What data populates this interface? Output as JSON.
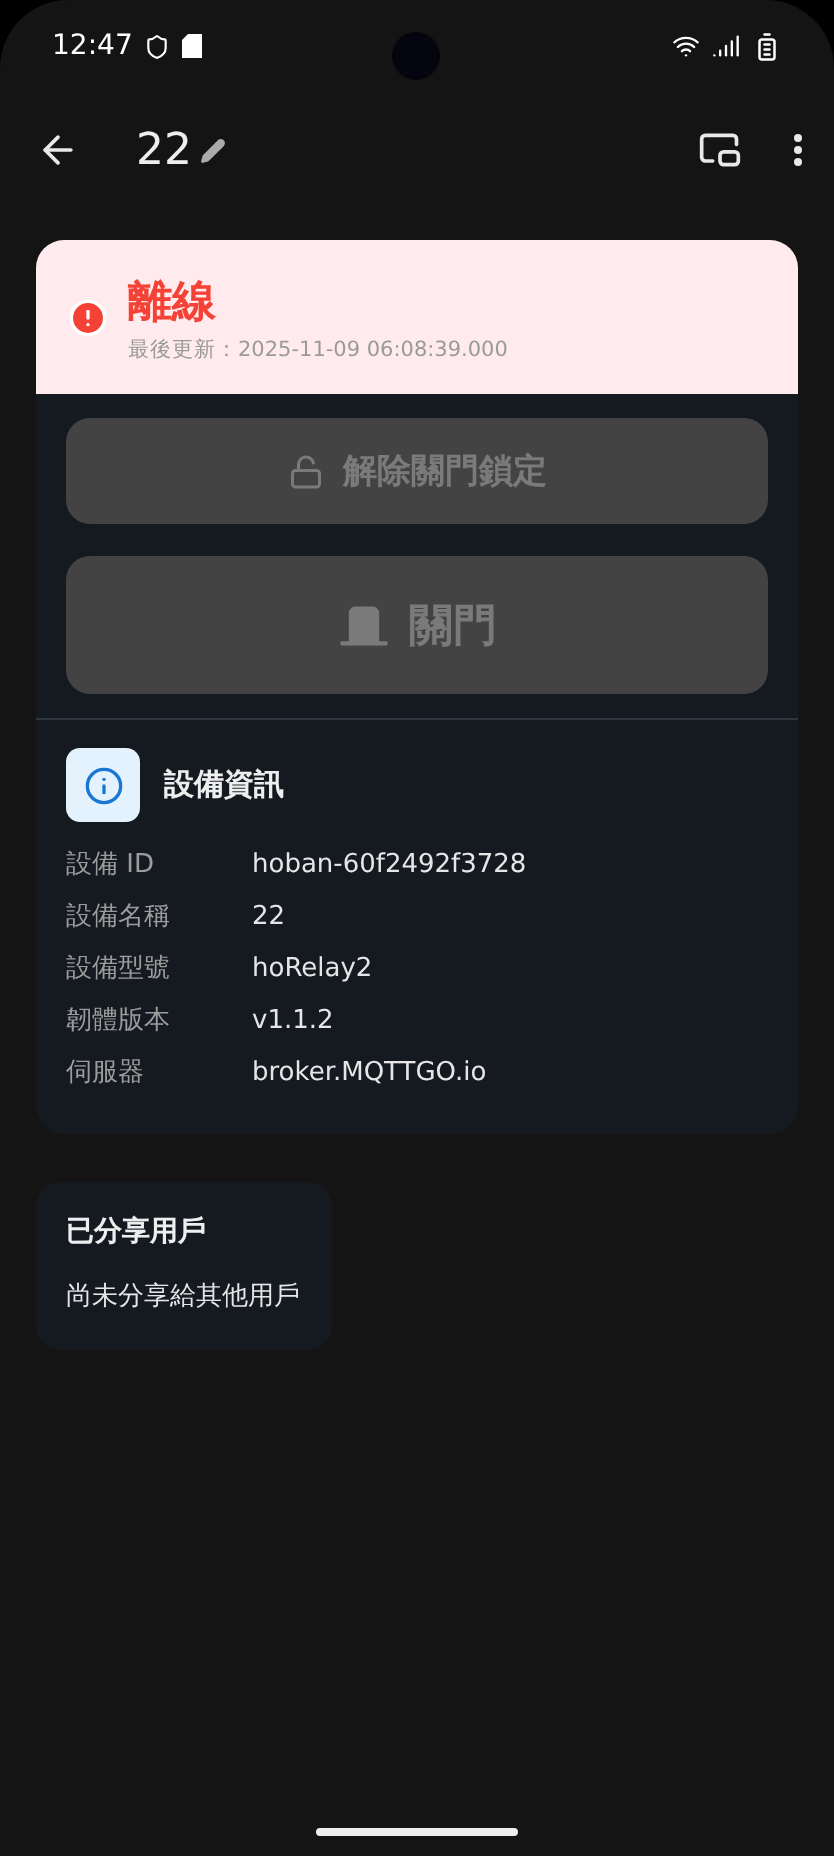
{
  "status_bar": {
    "time": "12:47"
  },
  "app_bar": {
    "title": "22"
  },
  "device_status": {
    "kind": "offline",
    "label": "離線",
    "updated": "最後更新：2025-11-09 06:08:39.000"
  },
  "actions": [
    {
      "kind": "unlock",
      "label": "解除關門鎖定",
      "disabled": true
    },
    {
      "kind": "door",
      "label": "關門",
      "disabled": true
    }
  ],
  "device_info": {
    "title": "設備資訊",
    "rows": [
      {
        "label": "設備 ID",
        "value": "hoban-60f2492f3728"
      },
      {
        "label": "設備名稱",
        "value": "22"
      },
      {
        "label": "設備型號",
        "value": "hoRelay2"
      },
      {
        "label": "韌體版本",
        "value": "v1.1.2"
      },
      {
        "label": "伺服器",
        "value": "broker.MQTTGO.io"
      }
    ]
  },
  "shared_users": {
    "title": "已分享用戶",
    "empty_message": "尚未分享給其他用戶"
  }
}
